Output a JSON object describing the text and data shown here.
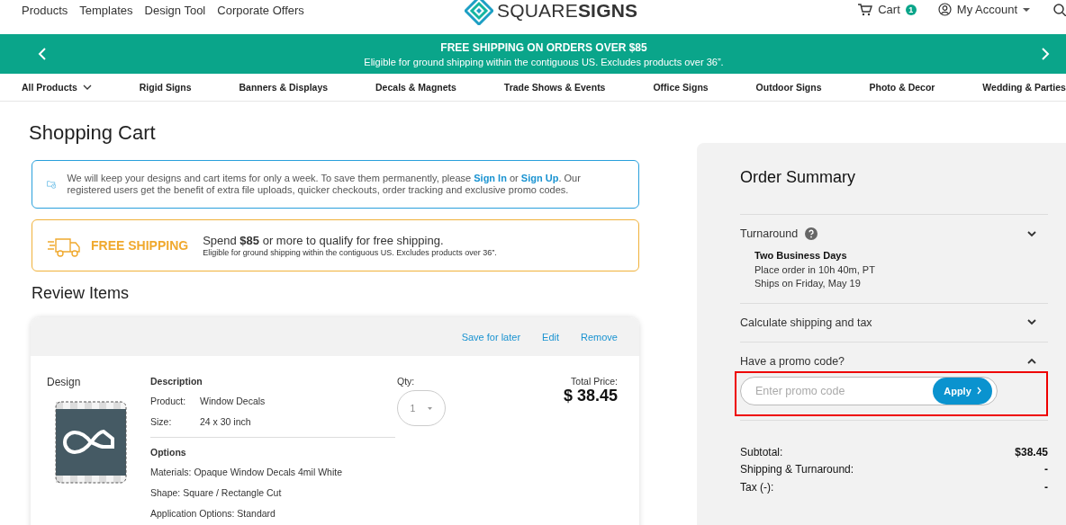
{
  "header": {
    "links": [
      "Products",
      "Templates",
      "Design Tool",
      "Corporate Offers"
    ],
    "logo": "SQUARE**SIGNS**",
    "cart": {
      "label": "Cart",
      "count": "1"
    },
    "account": "My Account"
  },
  "banner": {
    "title": "FREE SHIPPING ON ORDERS OVER $85",
    "subtitle": "Eligible for ground shipping within the contiguous US. Excludes products over 36”."
  },
  "categories": [
    {
      "label": "All Products",
      "dropdown": true
    },
    {
      "label": "Rigid Signs",
      "dropdown": false
    },
    {
      "label": "Banners & Displays",
      "dropdown": false
    },
    {
      "label": "Decals & Magnets",
      "dropdown": false
    },
    {
      "label": "Trade Shows & Events",
      "dropdown": false
    },
    {
      "label": "Office Signs",
      "dropdown": false
    },
    {
      "label": "Outdoor Signs",
      "dropdown": false
    },
    {
      "label": "Photo & Decor",
      "dropdown": false
    },
    {
      "label": "Wedding & Parties",
      "dropdown": false
    }
  ],
  "page_title": "Shopping Cart",
  "notice": {
    "parts": [
      {
        "kind": "text",
        "text": "We will keep your designs and cart items for only a week. To save them permanently, please "
      },
      {
        "kind": "link",
        "text": "Sign In"
      },
      {
        "kind": "text",
        "text": " or "
      },
      {
        "kind": "link",
        "text": "Sign Up"
      },
      {
        "kind": "text",
        "text": ". Our registered users get the benefit of extra file uploads, quicker checkouts, order tracking and exclusive promo codes."
      }
    ]
  },
  "shipping_notice": {
    "title": "FREE SHIPPING",
    "message": "Spend **$85** or more to qualify for free shipping.",
    "note": "Eligible for ground shipping within the contiguous US. Excludes products over 36”."
  },
  "review_title": "Review Items",
  "item": {
    "actions": [
      "Save for later",
      "Edit",
      "Remove"
    ],
    "design_label": "Design",
    "description_title": "Description",
    "details": [
      {
        "label": "Product:",
        "value": "Window Decals"
      },
      {
        "label": "Size:",
        "value": "24 x 30 inch"
      }
    ],
    "options_title": "Options",
    "options": [
      "Materials: Opaque Window Decals 4mil White",
      "Shape: Square / Rectangle Cut",
      "Application Options: Standard"
    ],
    "qty_label": "Qty:",
    "qty": "1",
    "total_label": "Total Price:",
    "total": "$ 38.45"
  },
  "summary": {
    "title": "Order Summary",
    "sections": [
      {
        "kind": "turnaround",
        "label": "Turnaround",
        "expanded": false,
        "details": [
          "Two Business Days",
          "Place order in 10h 40m, PT",
          "Ships on Friday, May 19"
        ]
      },
      {
        "kind": "plain",
        "label": "Calculate shipping and tax",
        "expanded": false
      },
      {
        "kind": "promo",
        "label": "Have a promo code?",
        "expanded": true,
        "placeholder": "Enter promo code",
        "button": "Apply",
        "highlighted": true
      }
    ],
    "totals": [
      {
        "label": "Subtotal:",
        "value": "$38.45"
      },
      {
        "label": "Shipping & Turnaround:",
        "value": "-"
      },
      {
        "label": "Tax (-):",
        "value": "-"
      }
    ]
  }
}
